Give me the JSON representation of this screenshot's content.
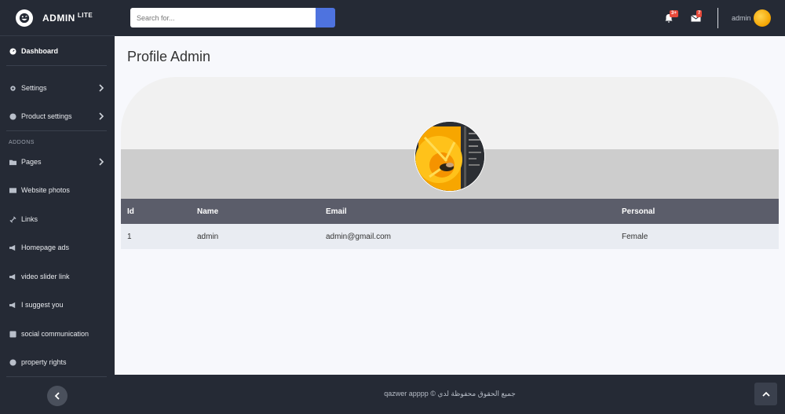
{
  "brand": {
    "name": "ADMIN",
    "suffix": "LITE"
  },
  "sidebar": {
    "dashboard": "Dashboard",
    "settings": "Settings",
    "product_settings": "Product settings",
    "addons_label": "ADDONS",
    "pages": "Pages",
    "website_photos": "Website photos",
    "links": "Links",
    "homepage_ads": "Homepage ads",
    "video_slider_link": "video slider link",
    "i_suggest_you": "I suggest you",
    "social_communication": "social communication",
    "property_rights": "property rights"
  },
  "topbar": {
    "search_placeholder": "Search for...",
    "alerts_badge": "3+",
    "messages_badge": "7",
    "user_name": "admin"
  },
  "main": {
    "title": "Profile Admin",
    "table": {
      "headers": [
        "Id",
        "Name",
        "Email",
        "Personal"
      ],
      "rows": [
        [
          "1",
          "admin",
          "admin@gmail.com",
          "Female"
        ]
      ]
    }
  },
  "footer": {
    "text": "qazwer apppp © جميع الحقوق محفوظة لدي"
  },
  "colors": {
    "sidebar_bg": "#252a35",
    "accent": "#4e73df",
    "badge": "#e74a3b",
    "table_head": "#5b5d6a"
  }
}
